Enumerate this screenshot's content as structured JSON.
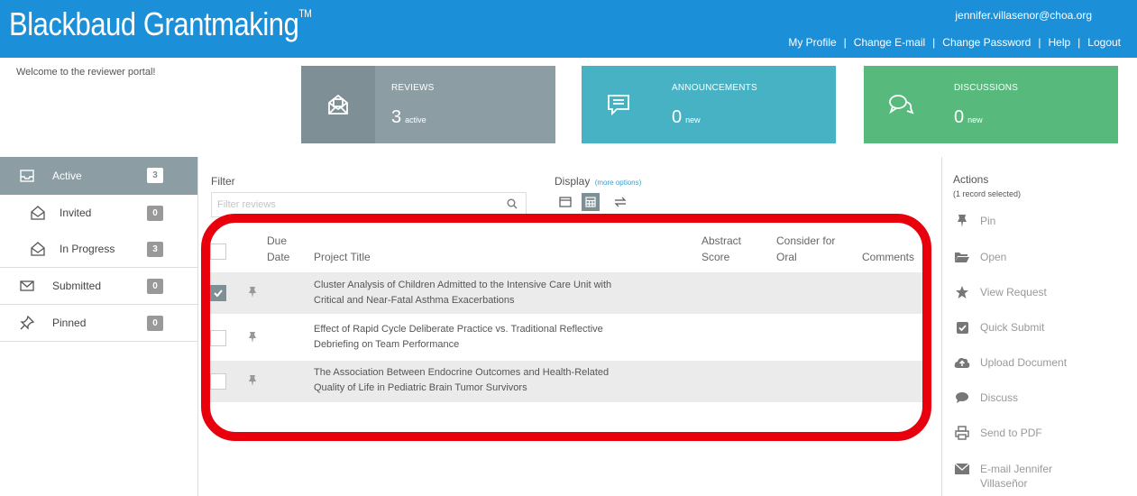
{
  "header": {
    "brand": "Blackbaud Grantmaking",
    "trademark": "TM",
    "user_email": "jennifer.villasenor@choa.org",
    "links": [
      "My Profile",
      "Change E-mail",
      "Change Password",
      "Help",
      "Logout"
    ],
    "separator": "|",
    "bg_color": "#1b8fd8"
  },
  "welcome": "Welcome to the reviewer portal!",
  "tiles": {
    "reviews": {
      "title": "REVIEWS",
      "count": "3",
      "suffix": "active",
      "icon": "envelope-open-icon"
    },
    "announcements": {
      "title": "ANNOUNCEMENTS",
      "count": "0",
      "suffix": "new",
      "icon": "message-icon"
    },
    "discussions": {
      "title": "DISCUSSIONS",
      "count": "0",
      "suffix": "new",
      "icon": "chat-bubbles-icon"
    }
  },
  "sidebar": {
    "items": [
      {
        "label": "Active",
        "count": "3",
        "icon": "inbox-icon",
        "active": true
      },
      {
        "label": "Invited",
        "count": "0",
        "icon": "envelope-open-icon"
      },
      {
        "label": "In Progress",
        "count": "3",
        "icon": "envelope-open-icon"
      },
      {
        "label": "Submitted",
        "count": "0",
        "icon": "envelope-icon"
      },
      {
        "label": "Pinned",
        "count": "0",
        "icon": "pin-icon"
      }
    ]
  },
  "filter": {
    "label": "Filter",
    "placeholder": "Filter reviews"
  },
  "display": {
    "label": "Display",
    "more": "(more options)"
  },
  "table": {
    "headers": {
      "due_date_line1": "Due",
      "due_date_line2": "Date",
      "project_title": "Project Title",
      "abstract_score_line1": "Abstract",
      "abstract_score_line2": "Score",
      "consider_line1": "Consider for",
      "consider_line2": "Oral",
      "comments": "Comments"
    },
    "rows": [
      {
        "checked": true,
        "title_line1": "Cluster Analysis of Children Admitted to the Intensive Care Unit with",
        "title_line2": "Critical and Near-Fatal Asthma Exacerbations"
      },
      {
        "checked": false,
        "title_line1": "Effect of Rapid Cycle Deliberate Practice vs. Traditional Reflective",
        "title_line2": "Debriefing on Team Performance"
      },
      {
        "checked": false,
        "title_line1": "The Association Between Endocrine Outcomes and Health-Related",
        "title_line2": "Quality of Life in Pediatric Brain Tumor Survivors"
      }
    ]
  },
  "actions": {
    "title": "Actions",
    "subtitle": "(1 record selected)",
    "items": [
      {
        "label": "Pin",
        "icon": "pin-icon"
      },
      {
        "label": "Open",
        "icon": "folder-open-icon"
      },
      {
        "label": "View Request",
        "icon": "star-icon"
      },
      {
        "label": "Quick Submit",
        "icon": "check-square-icon"
      },
      {
        "label": "Upload Document",
        "icon": "cloud-upload-icon"
      },
      {
        "label": "Discuss",
        "icon": "comment-icon"
      },
      {
        "label": "Send to PDF",
        "icon": "printer-icon"
      },
      {
        "label_line1": "E-mail Jennifer",
        "label_line2": "Villaseñor",
        "icon": "mail-icon"
      }
    ]
  },
  "colors": {
    "reviews_tile": "#8c9ea4",
    "announcements_tile": "#47b2c4",
    "discussions_tile": "#57b97c",
    "highlight_ring": "#e8000d"
  }
}
